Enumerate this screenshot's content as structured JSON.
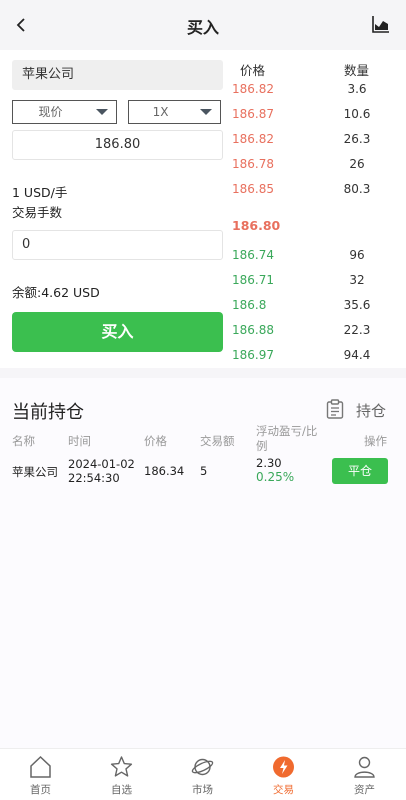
{
  "header": {
    "title": "买入"
  },
  "form": {
    "asset_name": "苹果公司",
    "order_type": "现价",
    "leverage": "1X",
    "price": "186.80",
    "unit": "1 USD/手",
    "fee_label": "交易手数",
    "quantity": "0",
    "balance": "余额:4.62 USD",
    "buy_label": "买入"
  },
  "orderbook": {
    "price_header": "价格",
    "qty_header": "数量",
    "asks": [
      {
        "price": "186.82",
        "qty": "3.6"
      },
      {
        "price": "186.87",
        "qty": "10.6"
      },
      {
        "price": "186.82",
        "qty": "26.3"
      },
      {
        "price": "186.78",
        "qty": "26"
      },
      {
        "price": "186.85",
        "qty": "80.3"
      }
    ],
    "mid": "186.80",
    "bids": [
      {
        "price": "186.74",
        "qty": "96"
      },
      {
        "price": "186.71",
        "qty": "32"
      },
      {
        "price": "186.8",
        "qty": "35.6"
      },
      {
        "price": "186.88",
        "qty": "22.3"
      },
      {
        "price": "186.97",
        "qty": "94.4"
      }
    ]
  },
  "positions": {
    "title": "当前持仓",
    "link_label": "持仓",
    "headers": {
      "name": "名称",
      "time": "时间",
      "price": "价格",
      "amount": "交易额",
      "pnl": "浮动盈亏/比例",
      "action": "操作"
    },
    "rows": [
      {
        "name": "苹果公司",
        "date": "2024-01-02",
        "time": "22:54:30",
        "price": "186.34",
        "amount": "5",
        "pnl": "2.30",
        "pnl_pct": "0.25%",
        "action_label": "平仓"
      }
    ]
  },
  "tabbar": {
    "items": [
      {
        "label": "首页",
        "icon": "home-icon"
      },
      {
        "label": "自选",
        "icon": "star-icon"
      },
      {
        "label": "市场",
        "icon": "planet-icon"
      },
      {
        "label": "交易",
        "icon": "trade-icon"
      },
      {
        "label": "资产",
        "icon": "user-icon"
      }
    ],
    "active_color": "#f06a2e"
  },
  "colors": {
    "accent_green": "#3bbf4f",
    "ask_red": "#e8705e",
    "bid_green": "#3aa85a"
  }
}
